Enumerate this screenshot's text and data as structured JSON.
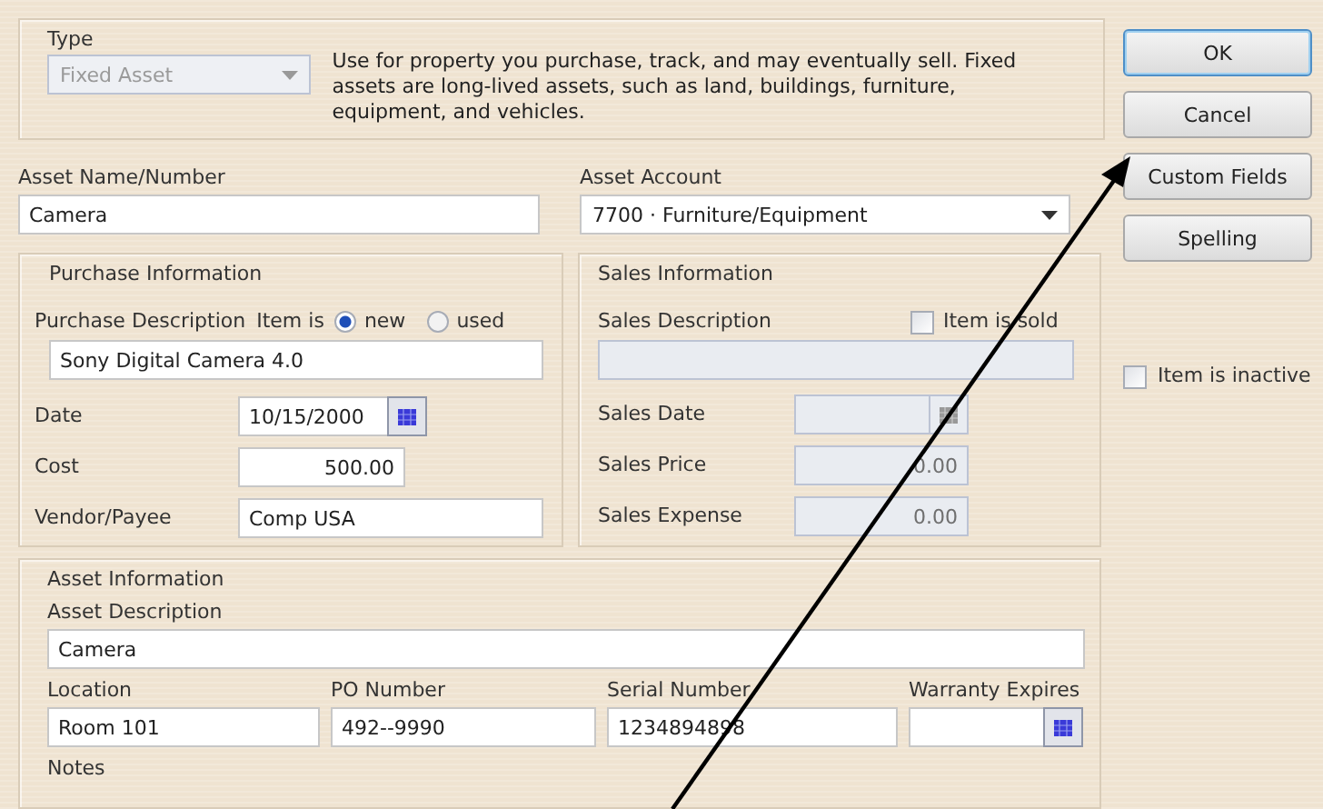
{
  "type_group": {
    "legend": "Type",
    "dropdown": {
      "value": "Fixed Asset",
      "disabled": true
    },
    "description": "Use for property you purchase, track, and may eventually sell.  Fixed assets are long-lived assets, such as land, buildings, furniture, equipment, and vehicles."
  },
  "asset_name": {
    "label": "Asset Name/Number",
    "value": "Camera"
  },
  "asset_account": {
    "label": "Asset Account",
    "value": "7700 · Furniture/Equipment"
  },
  "purchase": {
    "legend": "Purchase Information",
    "description_label": "Purchase Description",
    "item_is_label": "Item is",
    "conditions": [
      {
        "label": "new",
        "selected": true
      },
      {
        "label": "used",
        "selected": false
      }
    ],
    "description": "Sony Digital Camera 4.0",
    "fields": [
      {
        "kind": "date",
        "label": "Date",
        "value": "10/15/2000",
        "disabled": false
      },
      {
        "kind": "amount",
        "label": "Cost",
        "value": "500.00",
        "disabled": false
      },
      {
        "kind": "text",
        "label": "Vendor/Payee",
        "value": "Comp USA",
        "disabled": false
      }
    ]
  },
  "sales": {
    "legend": "Sales Information",
    "description_label": "Sales Description",
    "sold": {
      "label": "Item is sold",
      "checked": false
    },
    "description": {
      "disabled": true
    },
    "fields": [
      {
        "kind": "date",
        "label": "Sales Date",
        "disabled": true
      },
      {
        "kind": "amount",
        "label": "Sales Price",
        "value": "0.00",
        "disabled": true
      },
      {
        "kind": "amount",
        "label": "Sales Expense",
        "value": "0.00",
        "disabled": true
      }
    ]
  },
  "asset_info": {
    "legend": "Asset Information",
    "description_label": "Asset Description",
    "description": "Camera",
    "fields": [
      {
        "kind": "text",
        "label": "Location",
        "value": "Room 101"
      },
      {
        "kind": "text",
        "label": "PO Number",
        "value": "492--9990"
      },
      {
        "kind": "text",
        "label": "Serial Number",
        "value": "1234894898"
      },
      {
        "kind": "date",
        "label": "Warranty Expires"
      }
    ],
    "notes_label": "Notes"
  },
  "buttons": [
    {
      "label": "OK",
      "default": true
    },
    {
      "label": "Cancel",
      "default": false
    },
    {
      "label": "Custom Fields",
      "default": false
    },
    {
      "label": "Spelling",
      "default": false
    }
  ],
  "inactive": {
    "label": "Item is inactive",
    "checked": false
  }
}
